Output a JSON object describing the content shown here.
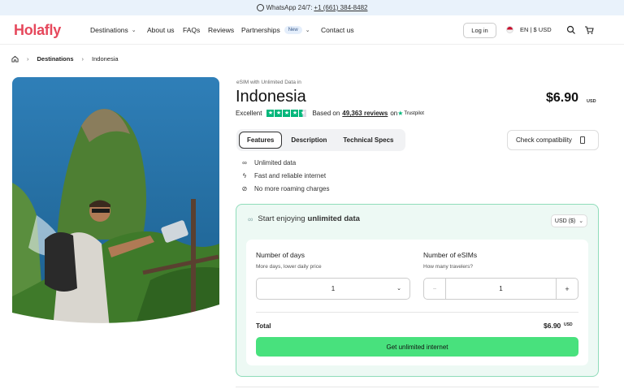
{
  "topbar": {
    "text": "WhatsApp 24/7:",
    "phone": "+1 (661) 384-8482"
  },
  "brand": {
    "logo": "Holafly",
    "color": "#e6485c"
  },
  "nav": {
    "destinations": "Destinations",
    "about": "About us",
    "faqs": "FAQs",
    "reviews": "Reviews",
    "partnerships": "Partnerships",
    "new_badge": "New",
    "contact": "Contact us",
    "login": "Log in",
    "lang": "EN | $ USD",
    "icons": [
      "chevron-down-icon",
      "search-icon",
      "cart-icon",
      "us-flag-icon",
      "home-icon"
    ]
  },
  "breadcrumb": {
    "current_parent": "Destinations",
    "current": "Indonesia"
  },
  "product": {
    "subtitle": "eSIM with Unlimited Data in",
    "title": "Indonesia",
    "price": "$6.90",
    "currency": "USD",
    "rating_word": "Excellent",
    "based_on": "Based on",
    "reviews": "49,363 reviews",
    "on": "on",
    "trustpilot": "Trustpilot",
    "stars": 4.5
  },
  "tabs": [
    "Features",
    "Description",
    "Technical Specs"
  ],
  "check_compat": "Check compatibility",
  "features": [
    {
      "icon": "infinity-icon",
      "text": "Unlimited data"
    },
    {
      "icon": "lightning-icon",
      "text": "Fast and reliable internet"
    },
    {
      "icon": "no-roaming-icon",
      "text": "No more roaming charges"
    }
  ],
  "plan": {
    "head_prefix": "Start enjoying",
    "head_bold": "unlimited data",
    "currency_select": "USD ($)",
    "days_label": "Number of days",
    "days_hint": "More days, lower daily price",
    "days_value": "1",
    "esims_label": "Number of eSIMs",
    "esims_hint": "How many travelers?",
    "esims_value": "1",
    "minus": "−",
    "plus": "+",
    "total_label": "Total",
    "total_value": "$6.90",
    "total_currency": "USD",
    "cta": "Get unlimited internet",
    "accent": "#48e17d"
  }
}
